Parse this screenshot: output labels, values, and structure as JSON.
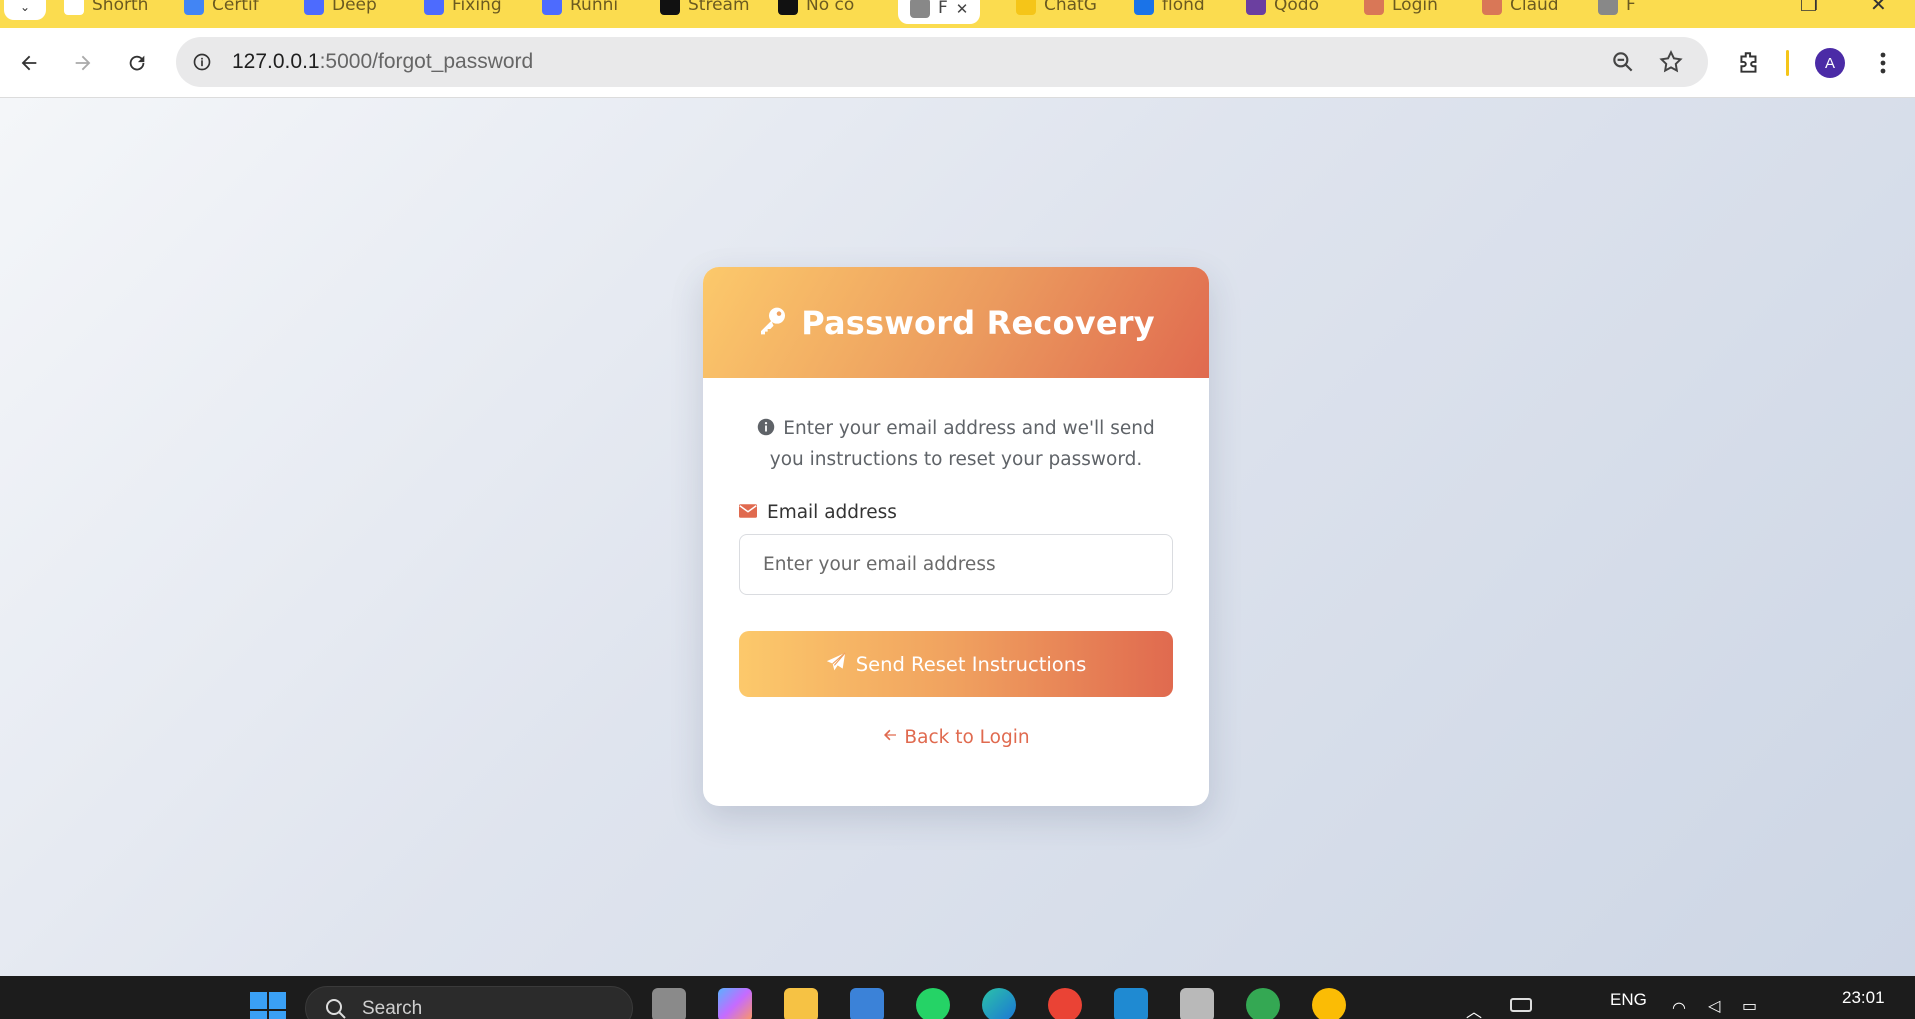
{
  "browser": {
    "tabs": [
      {
        "label": "Shorth",
        "color": "#ffffff"
      },
      {
        "label": "Certif",
        "color": "#4285f4"
      },
      {
        "label": "Deep",
        "color": "#4d6bfe"
      },
      {
        "label": "Fixing",
        "color": "#4d6bfe"
      },
      {
        "label": "Runni",
        "color": "#4d6bfe"
      },
      {
        "label": "Stream",
        "color": "#111111"
      },
      {
        "label": "No co",
        "color": "#111111"
      },
      {
        "label": "F",
        "color": "#888888"
      },
      {
        "label": "ChatG",
        "color": "#f5c518"
      },
      {
        "label": "flond",
        "color": "#1a73e8"
      },
      {
        "label": "Qodo",
        "color": "#6b3fa0"
      },
      {
        "label": "Login",
        "color": "#d97757"
      },
      {
        "label": "Claud",
        "color": "#d97757"
      },
      {
        "label": "F",
        "color": "#888888"
      }
    ],
    "url_host": "127.0.0.1",
    "url_path": ":5000/forgot_password",
    "avatar_letter": "A"
  },
  "card": {
    "title": "Password Recovery",
    "info_text": "Enter your email address and we'll send you instructions to reset your password.",
    "email_label": "Email address",
    "email_placeholder": "Enter your email address",
    "email_value": "",
    "submit_label": "Send Reset Instructions",
    "back_label": "Back to Login",
    "accent": "#e06a4f",
    "gradient_start": "#fcc96b",
    "gradient_end": "#e06a4f"
  },
  "taskbar": {
    "search_label": "Search",
    "language": "ENG",
    "time": "23:01"
  }
}
